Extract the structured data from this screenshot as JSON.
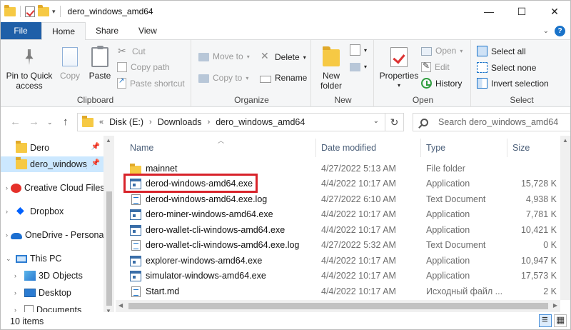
{
  "window": {
    "title": "dero_windows_amd64",
    "controls": {
      "minimize": "—",
      "maximize": "☐",
      "close": "✕"
    }
  },
  "ribbon_tabs": {
    "file": "File",
    "tabs": [
      "Home",
      "Share",
      "View"
    ],
    "active": "Home"
  },
  "ribbon": {
    "clipboard": {
      "label": "Clipboard",
      "pin": "Pin to Quick access",
      "pin_line1": "Pin to Quick",
      "pin_line2": "access",
      "copy": "Copy",
      "paste": "Paste",
      "cut": "Cut",
      "copy_path": "Copy path",
      "paste_shortcut": "Paste shortcut"
    },
    "organize": {
      "label": "Organize",
      "move_to": "Move to",
      "copy_to": "Copy to",
      "delete": "Delete",
      "rename": "Rename"
    },
    "new": {
      "label": "New",
      "new_folder_line1": "New",
      "new_folder_line2": "folder"
    },
    "open": {
      "label": "Open",
      "properties": "Properties",
      "open": "Open",
      "edit": "Edit",
      "history": "History"
    },
    "select": {
      "label": "Select",
      "select_all": "Select all",
      "select_none": "Select none",
      "invert_selection": "Invert selection"
    }
  },
  "address": {
    "prefix": "«",
    "crumbs": [
      "Disk (E:)",
      "Downloads",
      "dero_windows_amd64"
    ],
    "search_placeholder": "Search dero_windows_amd64"
  },
  "nav_pane": {
    "items": [
      {
        "label": "Dero",
        "icon": "folder-icon",
        "pinned": true
      },
      {
        "label": "dero_windows_amd64",
        "icon": "folder-icon",
        "pinned": true,
        "selected": true
      },
      {
        "label": "Creative Cloud Files",
        "icon": "creative-cloud-icon"
      },
      {
        "label": "Dropbox",
        "icon": "dropbox-icon"
      },
      {
        "label": "OneDrive - Personal",
        "icon": "onedrive-icon"
      },
      {
        "label": "This PC",
        "icon": "pc-icon"
      },
      {
        "label": "3D Objects",
        "icon": "3d-objects-icon"
      },
      {
        "label": "Desktop",
        "icon": "desktop-icon"
      },
      {
        "label": "Documents",
        "icon": "documents-icon"
      }
    ]
  },
  "file_list": {
    "columns": {
      "name": "Name",
      "date": "Date modified",
      "type": "Type",
      "size": "Size"
    },
    "rows": [
      {
        "name": "mainnet",
        "date": "4/27/2022 5:13 AM",
        "type": "File folder",
        "size": "",
        "icon": "folder-icon"
      },
      {
        "name": "derod-windows-amd64.exe",
        "date": "4/4/2022 10:17 AM",
        "type": "Application",
        "size": "15,728 K",
        "icon": "application-icon",
        "highlighted": true
      },
      {
        "name": "derod-windows-amd64.exe.log",
        "date": "4/27/2022 6:10 AM",
        "type": "Text Document",
        "size": "4,938 K",
        "icon": "text-document-icon"
      },
      {
        "name": "dero-miner-windows-amd64.exe",
        "date": "4/4/2022 10:17 AM",
        "type": "Application",
        "size": "7,781 K",
        "icon": "application-icon"
      },
      {
        "name": "dero-wallet-cli-windows-amd64.exe",
        "date": "4/4/2022 10:17 AM",
        "type": "Application",
        "size": "10,421 K",
        "icon": "application-icon"
      },
      {
        "name": "dero-wallet-cli-windows-amd64.exe.log",
        "date": "4/27/2022 5:32 AM",
        "type": "Text Document",
        "size": "0 K",
        "icon": "text-document-icon"
      },
      {
        "name": "explorer-windows-amd64.exe",
        "date": "4/4/2022 10:17 AM",
        "type": "Application",
        "size": "10,947 K",
        "icon": "application-icon"
      },
      {
        "name": "simulator-windows-amd64.exe",
        "date": "4/4/2022 10:17 AM",
        "type": "Application",
        "size": "17,573 K",
        "icon": "application-icon"
      },
      {
        "name": "Start.md",
        "date": "4/4/2022 10:17 AM",
        "type": "Исходный файл ...",
        "size": "2 K",
        "icon": "markdown-file-icon"
      }
    ]
  },
  "status_bar": {
    "item_count": "10 items"
  },
  "colors": {
    "file_tab": "#1f5fa8",
    "selection": "#cce8ff",
    "highlight_box": "#d8232a",
    "folder": "#f6c944"
  }
}
